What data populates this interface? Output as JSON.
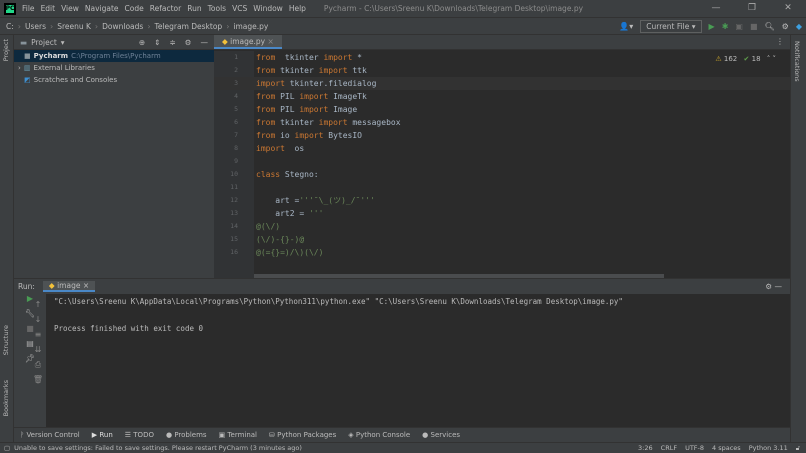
{
  "titlebar": {
    "logo": "PC",
    "menu": [
      "File",
      "Edit",
      "View",
      "Navigate",
      "Code",
      "Refactor",
      "Run",
      "Tools",
      "VCS",
      "Window",
      "Help"
    ],
    "title": "Pycharm - C:\\Users\\Sreenu K\\Downloads\\Telegram Desktop\\image.py"
  },
  "navbar": {
    "crumbs": [
      "Users",
      "Sreenu K",
      "Downloads",
      "Telegram Desktop",
      "image.py"
    ],
    "run_config": "Current File"
  },
  "leftstrip": {
    "project": "Project",
    "structure": "Structure",
    "bookmarks": "Bookmarks"
  },
  "rightstrip": {
    "notifications": "Notifications"
  },
  "project": {
    "title": "Project",
    "items": [
      {
        "name": "Pycharm",
        "path": "C:\\Program Files\\Pycharm"
      },
      {
        "name": "External Libraries"
      },
      {
        "name": "Scratches and Consoles"
      }
    ]
  },
  "editor": {
    "tab": "image.py",
    "warnings": "162",
    "checks": "18",
    "lines": [
      {
        "n": "1",
        "parts": [
          [
            "kw",
            "from"
          ],
          [
            "",
            "  tkinter "
          ],
          [
            "kw",
            "import"
          ],
          [
            "",
            " *"
          ]
        ]
      },
      {
        "n": "2",
        "parts": [
          [
            "kw",
            "from"
          ],
          [
            "",
            " tkinter "
          ],
          [
            "kw",
            "import"
          ],
          [
            "",
            " ttk"
          ]
        ]
      },
      {
        "n": "3",
        "parts": [
          [
            "kw",
            "import"
          ],
          [
            "",
            " tkinter.filedialog"
          ]
        ]
      },
      {
        "n": "4",
        "parts": [
          [
            "kw",
            "from"
          ],
          [
            "",
            " PIL "
          ],
          [
            "kw",
            "import"
          ],
          [
            "",
            " ImageTk"
          ]
        ]
      },
      {
        "n": "5",
        "parts": [
          [
            "kw",
            "from"
          ],
          [
            "",
            " PIL "
          ],
          [
            "kw",
            "import"
          ],
          [
            "",
            " Image"
          ]
        ]
      },
      {
        "n": "6",
        "parts": [
          [
            "kw",
            "from"
          ],
          [
            "",
            " tkinter "
          ],
          [
            "kw",
            "import"
          ],
          [
            "",
            " messagebox"
          ]
        ]
      },
      {
        "n": "7",
        "parts": [
          [
            "kw",
            "from"
          ],
          [
            "",
            " io "
          ],
          [
            "kw",
            "import"
          ],
          [
            "",
            " BytesIO"
          ]
        ]
      },
      {
        "n": "8",
        "parts": [
          [
            "kw",
            "import"
          ],
          [
            "",
            "  os"
          ]
        ]
      },
      {
        "n": "9",
        "parts": []
      },
      {
        "n": "10",
        "parts": [
          [
            "kw",
            "class"
          ],
          [
            "",
            " Stegno:"
          ]
        ]
      },
      {
        "n": "11",
        "parts": []
      },
      {
        "n": "12",
        "parts": [
          [
            "",
            "    art ="
          ],
          [
            "str",
            "'''¯\\_(ツ)_/¯'''"
          ]
        ]
      },
      {
        "n": "13",
        "parts": [
          [
            "",
            "    art2 = "
          ],
          [
            "str",
            "'''"
          ]
        ]
      },
      {
        "n": "14",
        "parts": [
          [
            "str",
            "@(\\/)"
          ]
        ]
      },
      {
        "n": "15",
        "parts": [
          [
            "str",
            "(\\/)-{}-)@"
          ]
        ]
      },
      {
        "n": "16",
        "parts": [
          [
            "str",
            "@(={}=)/\\)(\\/)"
          ]
        ]
      }
    ]
  },
  "run": {
    "label": "Run:",
    "tab": "image",
    "cmd": "\"C:\\Users\\Sreenu K\\AppData\\Local\\Programs\\Python\\Python311\\python.exe\" \"C:\\Users\\Sreenu K\\Downloads\\Telegram Desktop\\image.py\"",
    "exit": "Process finished with exit code 0"
  },
  "toolwindows": [
    "Version Control",
    "Run",
    "TODO",
    "Problems",
    "Terminal",
    "Python Packages",
    "Python Console",
    "Services"
  ],
  "status": {
    "message": "Unable to save settings: Failed to save settings. Please restart PyCharm (3 minutes ago)",
    "position": "3:26",
    "line_sep": "CRLF",
    "encoding": "UTF-8",
    "indent": "4 spaces",
    "interpreter": "Python 3.11"
  }
}
